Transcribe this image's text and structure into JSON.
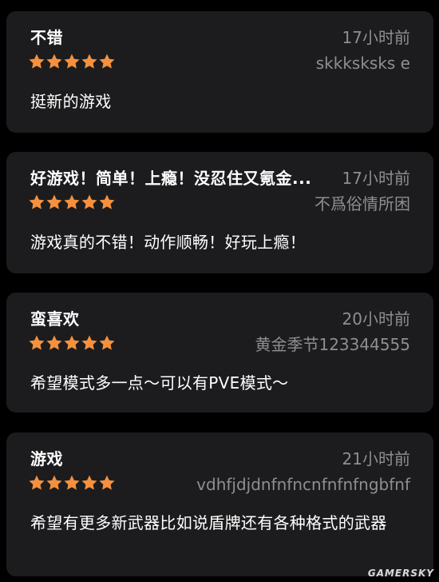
{
  "colors": {
    "background": "#000000",
    "card": "#1c1c1e",
    "star": "#f5913e",
    "secondary_text": "#8e8e93"
  },
  "reviews": [
    {
      "title": "不错",
      "time": "17小时前",
      "author": "skkksksks e",
      "rating": 5,
      "body": "挺新的游戏"
    },
    {
      "title": "好游戏！简单！上瘾！没忍住又氪金...",
      "time": "17小时前",
      "author": "不爲俗情所困",
      "rating": 5,
      "body": "游戏真的不错！动作顺畅！好玩上瘾！"
    },
    {
      "title": "蛮喜欢",
      "time": "20小时前",
      "author": "黄金季节123344555",
      "rating": 5,
      "body": "希望模式多一点～可以有PVE模式～"
    },
    {
      "title": "游戏",
      "time": "21小时前",
      "author": "vdhfjdjdnfnfncnfnfnfngbfnf",
      "rating": 5,
      "body": "希望有更多新武器比如说盾牌还有各种格式的武器"
    }
  ],
  "watermark": "GAMERSKY"
}
